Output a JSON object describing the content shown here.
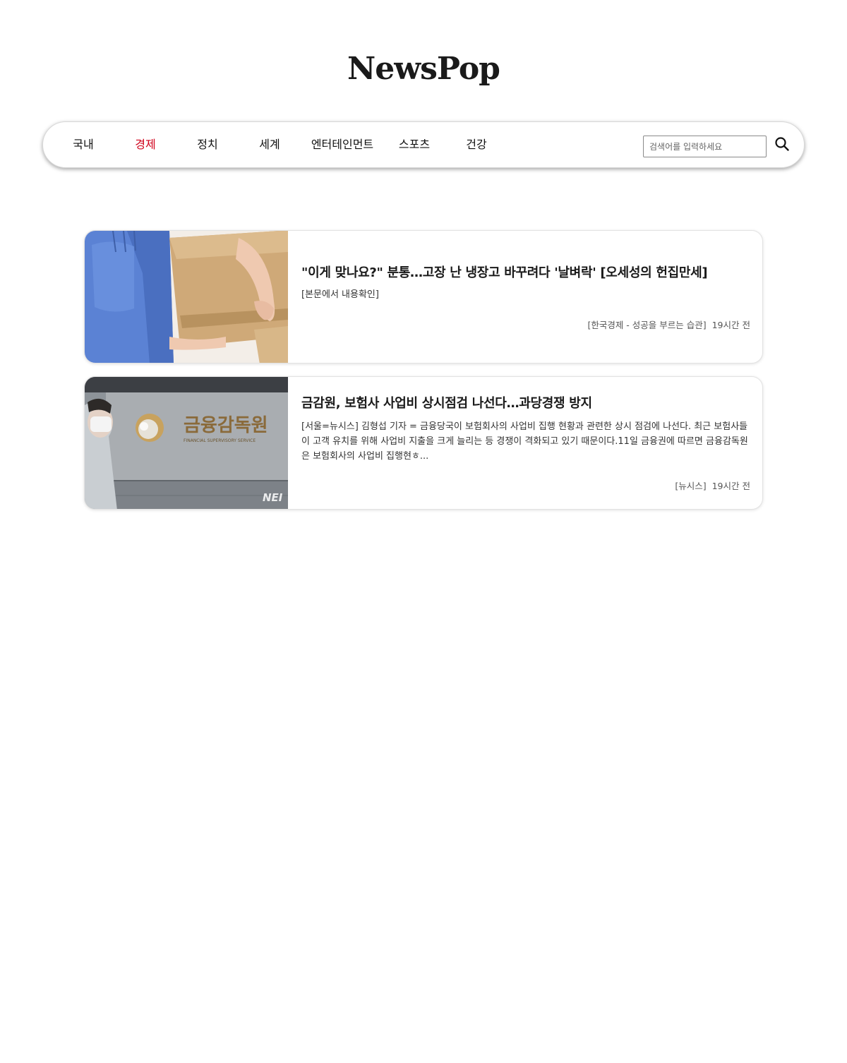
{
  "site": {
    "logo": "NewsPop"
  },
  "nav": {
    "items": [
      {
        "label": "국내",
        "active": false
      },
      {
        "label": "경제",
        "active": true
      },
      {
        "label": "정치",
        "active": false
      },
      {
        "label": "세계",
        "active": false
      },
      {
        "label": "엔터테인먼트",
        "active": false
      },
      {
        "label": "스포츠",
        "active": false
      },
      {
        "label": "건강",
        "active": false
      }
    ],
    "search": {
      "placeholder": "검색어를 입력하세요",
      "icon": "search-icon"
    }
  },
  "articles": [
    {
      "title": "\"이게 맞나요?\" 분통…고장 난 냉장고 바꾸려다 '날벼락' [오세성의 헌집만세]",
      "summary": "[본문에서 내용확인]",
      "source": "[한국경제 - 성공을 부르는 습관]",
      "time": "19시간 전",
      "thumbnail": "delivery-box-photo"
    },
    {
      "title": "금감원, 보험사 사업비 상시점검 나선다…과당경쟁 방지",
      "summary": "[서울=뉴시스] 김형섭 기자 = 금융당국이 보험회사의 사업비 집행 현황과 관련한 상시 점검에 나선다. 최근 보험사들이 고객 유치를 위해 사업비 지출을 크게 늘리는 등 경쟁이 격화되고 있기 때문이다.11일 금융권에 따르면 금융감독원은 보험회사의 사업비 집행현ㅎ...",
      "source": "[뉴시스]",
      "time": "19시간 전",
      "thumbnail": "fss-building-sign-photo",
      "thumbnail_text": {
        "sign_korean": "금융감독원",
        "sign_english": "FINANCIAL SUPERVISORY SERVICE",
        "watermark": "NEI"
      }
    }
  ],
  "colors": {
    "active_nav": "#d0021b",
    "text": "#222222",
    "border": "#e2e2e2"
  }
}
